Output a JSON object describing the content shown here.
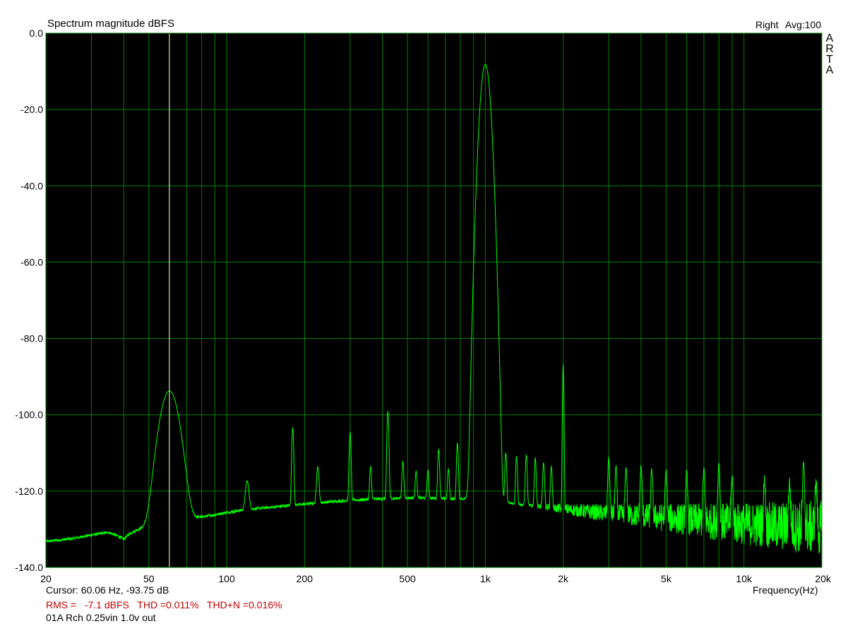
{
  "header": {
    "title": "Spectrum magnitude dBFS",
    "channel": "Right",
    "averaging": "Avg:100",
    "watermark": [
      "A",
      "R",
      "T",
      "A"
    ]
  },
  "footer": {
    "cursor": "Cursor: 60.06 Hz, -93.75 dB",
    "rms": "RMS =   -7.1 dBFS   THD =0.011%   THD+N =0.016%",
    "note": "01A Rch 0.25vin 1.0v out"
  },
  "colors": {
    "background": "#000000",
    "grid": "#008000",
    "trace": "#00ff00",
    "cursor": "#ffffcc",
    "stats": "#c00000"
  },
  "chart_data": {
    "type": "line",
    "title": "Spectrum magnitude dBFS",
    "xlabel": "Frequency(Hz)",
    "ylabel": "",
    "x_scale": "log",
    "xlim": [
      20,
      20000
    ],
    "ylim": [
      -140,
      0
    ],
    "grid": true,
    "x_ticks": [
      {
        "value": 20,
        "label": "20"
      },
      {
        "value": 50,
        "label": "50"
      },
      {
        "value": 100,
        "label": "100"
      },
      {
        "value": 200,
        "label": "200"
      },
      {
        "value": 500,
        "label": "500"
      },
      {
        "value": 1000,
        "label": "1k"
      },
      {
        "value": 2000,
        "label": "2k"
      },
      {
        "value": 5000,
        "label": "5k"
      },
      {
        "value": 10000,
        "label": "10k"
      },
      {
        "value": 20000,
        "label": "20k"
      }
    ],
    "y_ticks": [
      {
        "value": 0,
        "label": "0.0"
      },
      {
        "value": -20,
        "label": "-20.0"
      },
      {
        "value": -40,
        "label": "-40.0"
      },
      {
        "value": -60,
        "label": "-60.0"
      },
      {
        "value": -80,
        "label": "-80.0"
      },
      {
        "value": -100,
        "label": "-100.0"
      },
      {
        "value": -120,
        "label": "-120.0"
      },
      {
        "value": -140,
        "label": "-140.0"
      }
    ],
    "cursor": {
      "x": 60.06,
      "y": -93.75
    },
    "noise_floor": [
      [
        20,
        -133.2
      ],
      [
        25,
        -132.5
      ],
      [
        30,
        -131.5
      ],
      [
        35,
        -130.8
      ],
      [
        38,
        -131.8
      ],
      [
        40,
        -132.6
      ],
      [
        42,
        -131.2
      ],
      [
        45,
        -130.2
      ],
      [
        50,
        -129.4
      ],
      [
        55,
        -128.8
      ],
      [
        58,
        -128.5
      ],
      [
        65,
        -127.8
      ],
      [
        70,
        -127.4
      ],
      [
        80,
        -126.8
      ],
      [
        90,
        -126.2
      ],
      [
        100,
        -125.6
      ],
      [
        120,
        -124.8
      ],
      [
        150,
        -124.2
      ],
      [
        200,
        -123.4
      ],
      [
        250,
        -122.8
      ],
      [
        300,
        -122.4
      ],
      [
        400,
        -122.0
      ],
      [
        500,
        -121.8
      ],
      [
        600,
        -121.8
      ],
      [
        700,
        -122.0
      ],
      [
        800,
        -122.1
      ],
      [
        900,
        -121.5
      ],
      [
        1100,
        -122.8
      ],
      [
        1500,
        -123.8
      ],
      [
        2000,
        -124.7
      ],
      [
        3000,
        -125.9
      ],
      [
        5000,
        -127.0
      ],
      [
        7000,
        -127.8
      ],
      [
        10000,
        -128.6
      ],
      [
        15000,
        -129.3
      ],
      [
        20000,
        -129.8
      ]
    ],
    "peaks": [
      {
        "f": 60.06,
        "db": -93.75,
        "w": 0.028
      },
      {
        "f": 120,
        "db": -122.0,
        "w": 0.006
      },
      {
        "f": 180,
        "db": -104.0,
        "w": 0.003
      },
      {
        "f": 225,
        "db": -117.0,
        "w": 0.004
      },
      {
        "f": 300,
        "db": -105.5,
        "w": 0.003
      },
      {
        "f": 360,
        "db": -117.5,
        "w": 0.003
      },
      {
        "f": 420,
        "db": -99.5,
        "w": 0.003
      },
      {
        "f": 480,
        "db": -115.5,
        "w": 0.003
      },
      {
        "f": 540,
        "db": -119.5,
        "w": 0.003
      },
      {
        "f": 600,
        "db": -119.0,
        "w": 0.003
      },
      {
        "f": 660,
        "db": -111.0,
        "w": 0.003
      },
      {
        "f": 720,
        "db": -118.5,
        "w": 0.003
      },
      {
        "f": 780,
        "db": -109.0,
        "w": 0.003
      },
      {
        "f": 900,
        "db": -112.5,
        "w": 0.003
      },
      {
        "f": 1000,
        "db": -8.0,
        "w": 0.013
      },
      {
        "f": 1140,
        "db": -118.0,
        "w": 0.003
      },
      {
        "f": 1200,
        "db": -112.0,
        "w": 0.003
      },
      {
        "f": 1320,
        "db": -113.0,
        "w": 0.003
      },
      {
        "f": 1440,
        "db": -112.5,
        "w": 0.003
      },
      {
        "f": 1560,
        "db": -113.5,
        "w": 0.003
      },
      {
        "f": 1680,
        "db": -115.0,
        "w": 0.003
      },
      {
        "f": 1800,
        "db": -116.5,
        "w": 0.003
      },
      {
        "f": 2000,
        "db": -87.0,
        "w": 0.002
      },
      {
        "f": 3000,
        "db": -113.0,
        "w": 0.003
      },
      {
        "f": 3200,
        "db": -116.0,
        "w": 0.003
      },
      {
        "f": 3500,
        "db": -116.5,
        "w": 0.003
      },
      {
        "f": 4000,
        "db": -115.5,
        "w": 0.003
      },
      {
        "f": 4400,
        "db": -117.0,
        "w": 0.003
      },
      {
        "f": 5000,
        "db": -117.0,
        "w": 0.003
      },
      {
        "f": 6000,
        "db": -117.5,
        "w": 0.003
      },
      {
        "f": 7000,
        "db": -116.0,
        "w": 0.003
      },
      {
        "f": 8000,
        "db": -114.0,
        "w": 0.003
      },
      {
        "f": 9000,
        "db": -118.5,
        "w": 0.003
      },
      {
        "f": 12000,
        "db": -120.0,
        "w": 0.003
      },
      {
        "f": 15000,
        "db": -120.5,
        "w": 0.003
      },
      {
        "f": 17000,
        "db": -114.5,
        "w": 0.003
      },
      {
        "f": 19000,
        "db": -120.5,
        "w": 0.003
      }
    ]
  }
}
